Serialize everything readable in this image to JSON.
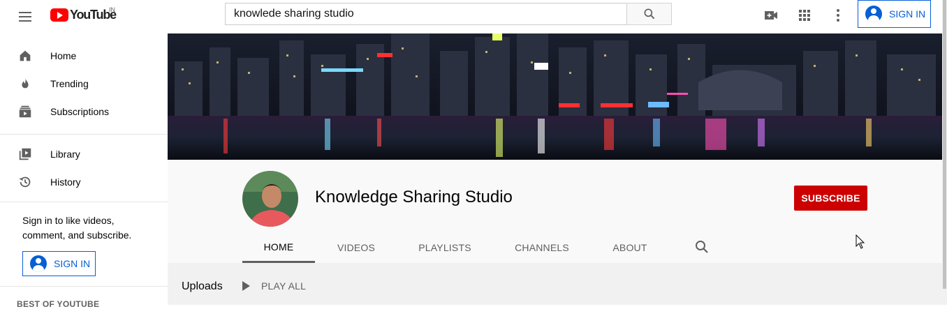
{
  "header": {
    "logo_text": "YouTube",
    "country_code": "IN",
    "search_value": "knowlede sharing studio",
    "sign_in_label": "SIGN IN",
    "icons": [
      "menu-icon",
      "search-icon",
      "create-video-icon",
      "apps-grid-icon",
      "more-vert-icon"
    ]
  },
  "sidebar": {
    "items": [
      {
        "label": "Home",
        "icon": "home-icon"
      },
      {
        "label": "Trending",
        "icon": "flame-icon"
      },
      {
        "label": "Subscriptions",
        "icon": "subscriptions-icon"
      },
      {
        "label": "Library",
        "icon": "library-icon"
      },
      {
        "label": "History",
        "icon": "history-icon"
      }
    ],
    "signin_prompt": "Sign in to like videos, comment, and subscribe.",
    "sign_in_label": "SIGN IN",
    "section_heading": "BEST OF YOUTUBE"
  },
  "channel": {
    "name": "Knowledge Sharing Studio",
    "subscribe_label": "SUBSCRIBE",
    "tabs": [
      {
        "label": "HOME",
        "active": true
      },
      {
        "label": "VIDEOS",
        "active": false
      },
      {
        "label": "PLAYLISTS",
        "active": false
      },
      {
        "label": "CHANNELS",
        "active": false
      },
      {
        "label": "ABOUT",
        "active": false
      }
    ],
    "section_title": "Uploads",
    "play_all_label": "PLAY ALL"
  },
  "colors": {
    "brand_red": "#ff0000",
    "subscribe_red": "#cc0000",
    "link_blue": "#065fd4"
  }
}
